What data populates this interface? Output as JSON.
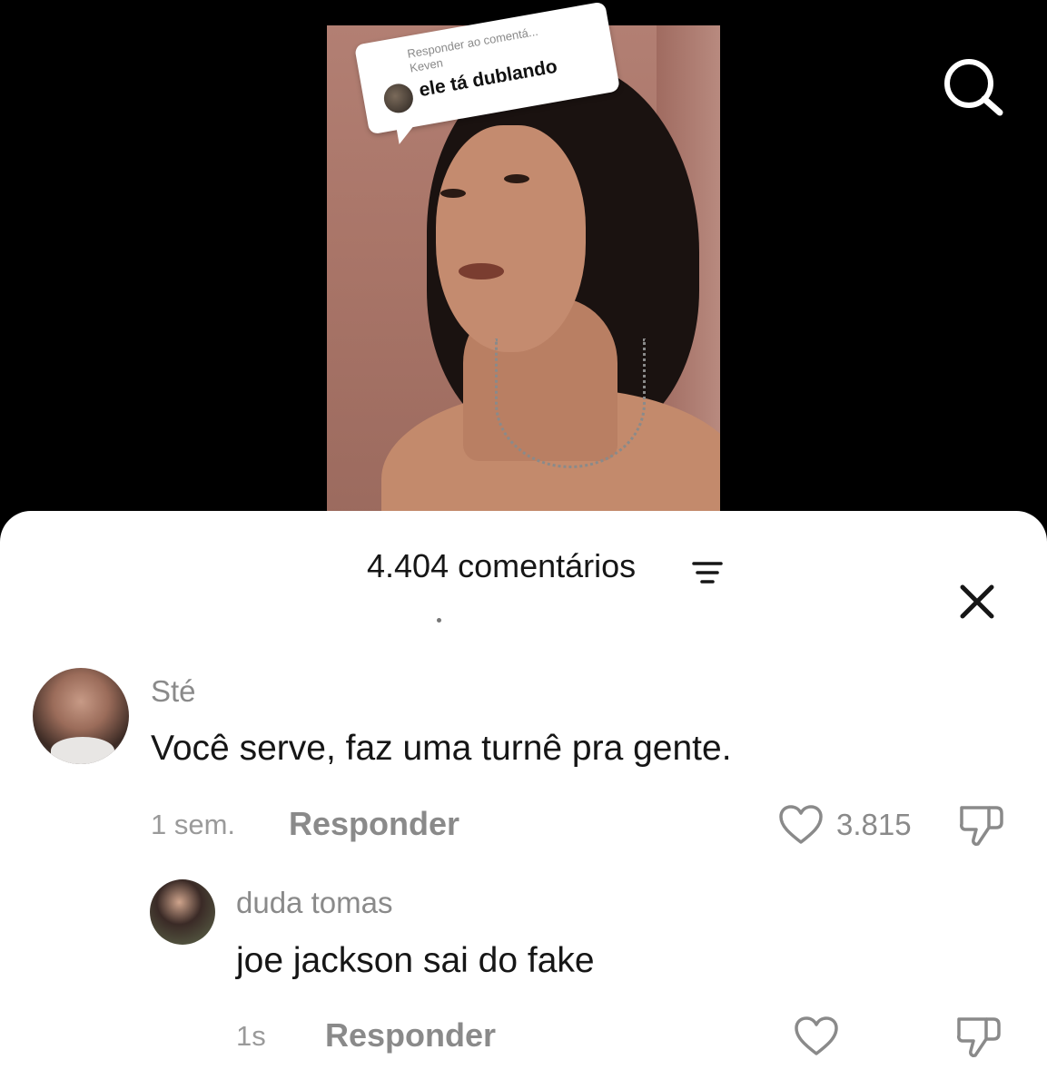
{
  "video": {
    "reply_bubble": {
      "label": "Responder ao comentá...",
      "user": "Keven",
      "text": "ele tá dublando"
    },
    "search_icon": "search-icon"
  },
  "comments_sheet": {
    "count_label": "4.404 comentários",
    "filter_icon": "filter-icon",
    "close_icon": "close-icon",
    "comments": [
      {
        "username": "Sté",
        "text": "Você serve, faz uma turnê pra gente.",
        "time": "1 sem.",
        "reply_label": "Responder",
        "likes": "3.815"
      }
    ],
    "replies": [
      {
        "username": "duda tomas",
        "text": "joe jackson sai do fake",
        "time": "1s",
        "reply_label": "Responder",
        "likes": ""
      }
    ]
  },
  "colors": {
    "sheet_bg": "#ffffff",
    "background": "#000000",
    "muted_text": "#8a8a8a",
    "primary_text": "#161616"
  }
}
